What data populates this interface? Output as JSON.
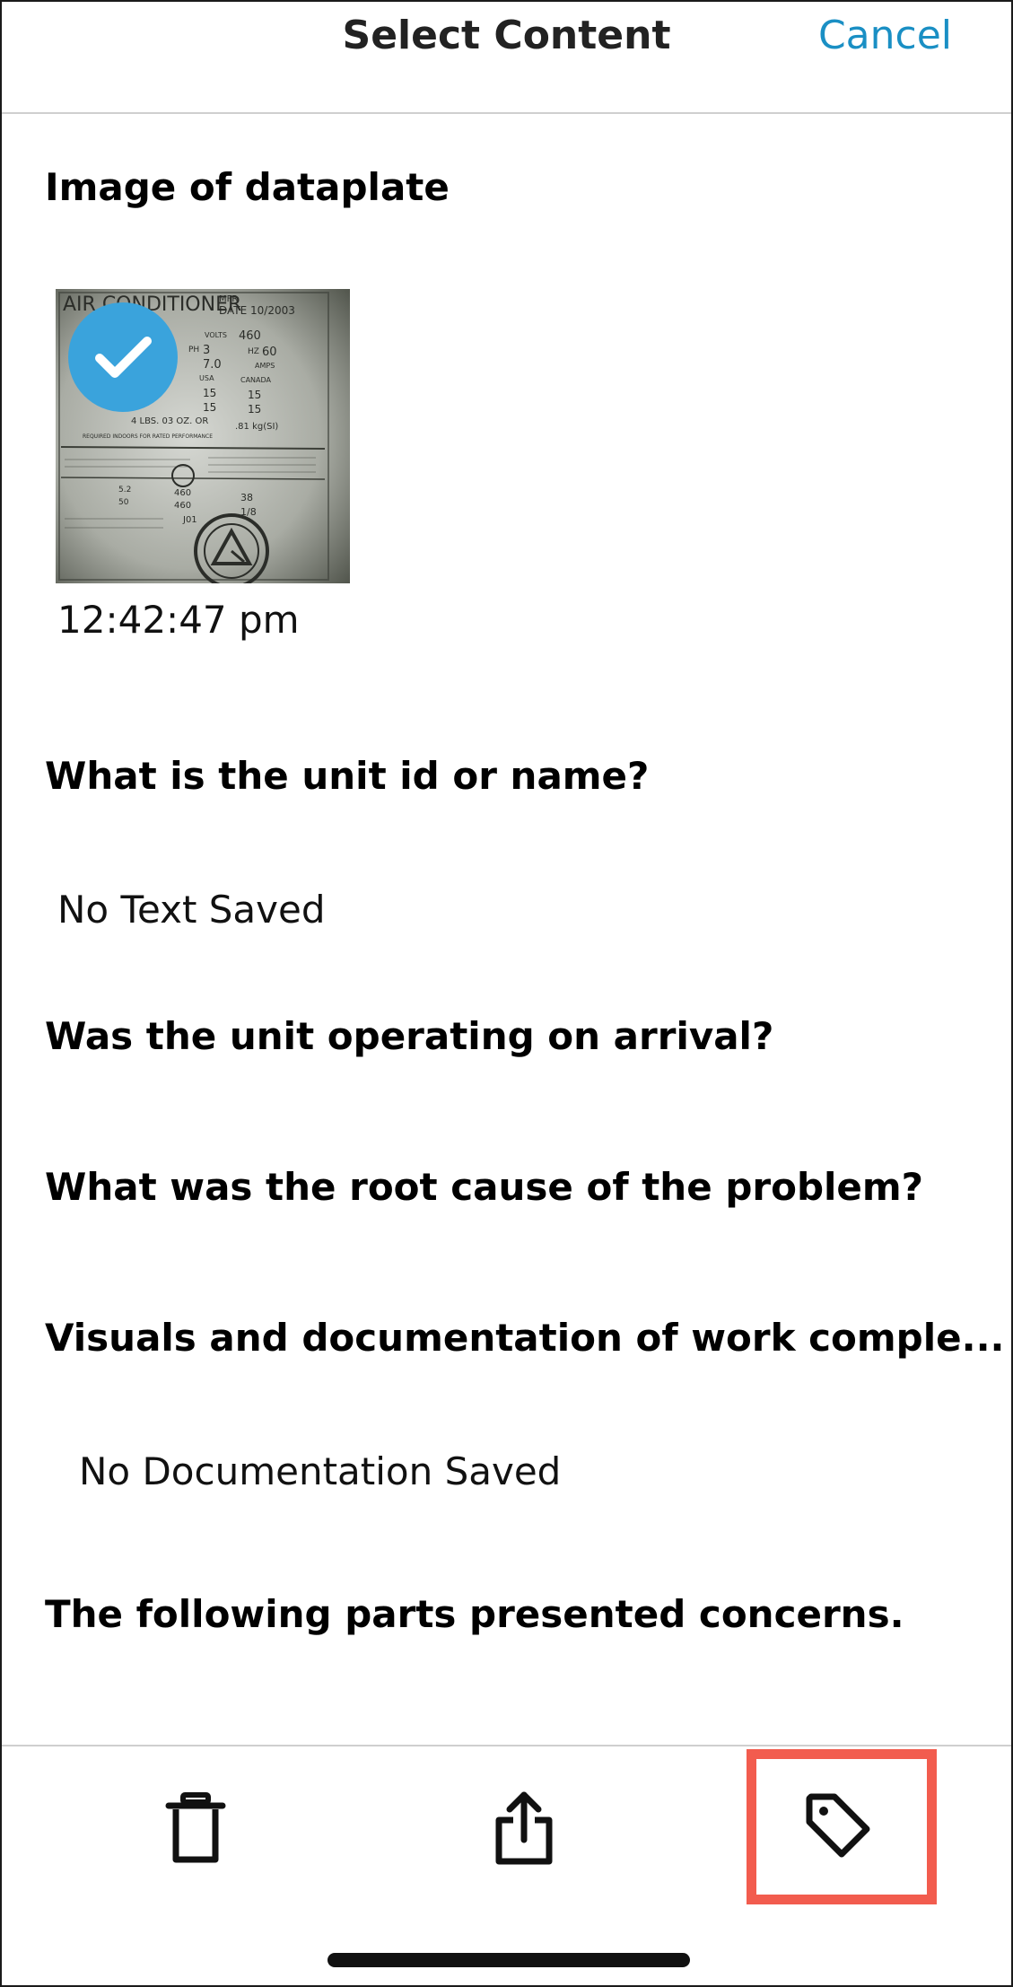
{
  "header": {
    "title": "Select Content",
    "cancel_label": "Cancel"
  },
  "sections": {
    "dataplate": {
      "heading": "Image of dataplate",
      "photo_timestamp": "12:42:47 pm",
      "photo_selected": true,
      "photo_text": {
        "title": "AIR CONDITIONER",
        "mfr": "MFR",
        "date": "DATE 10/2003",
        "volts_label": "VOLTS",
        "volts_value": "460",
        "ph_label": "PH",
        "ph_value": "3",
        "hz_label": "HZ",
        "hz_value": "60",
        "amps_value": "7.0",
        "amps_label": "AMPS",
        "usa_label": "USA",
        "canada_label": "CANADA",
        "row_a_1": "15",
        "row_a_2": "15",
        "row_b_1": "15",
        "row_b_2": "15",
        "weight": ".81 kg(SI)",
        "line_c": "4 LBS. 03 OZ. OR",
        "line_d": "REQUIRED INDOORS FOR RATED PERFORMANCE",
        "row_e_1": "460",
        "row_e_2": "460",
        "row_f": "38",
        "row_g": "1/8",
        "row_h": "J01",
        "row_i": "5.2",
        "row_j": "50"
      }
    },
    "unit_id": {
      "heading": "What is the unit id or name?",
      "value": "No Text Saved"
    },
    "operating": {
      "heading": "Was the unit operating on arrival?"
    },
    "root_cause": {
      "heading": "What was the root cause of the problem?"
    },
    "visuals": {
      "heading": "Visuals and documentation of work comple...",
      "value": "No Documentation Saved"
    },
    "parts": {
      "heading": "The following parts presented concerns."
    }
  },
  "toolbar": {
    "delete_icon": "trash-icon",
    "share_icon": "share-icon",
    "tag_icon": "tag-icon",
    "highlight_color": "#f25c4e"
  },
  "colors": {
    "accent": "#1a8fc4",
    "check_badge": "#3aa3dc"
  }
}
